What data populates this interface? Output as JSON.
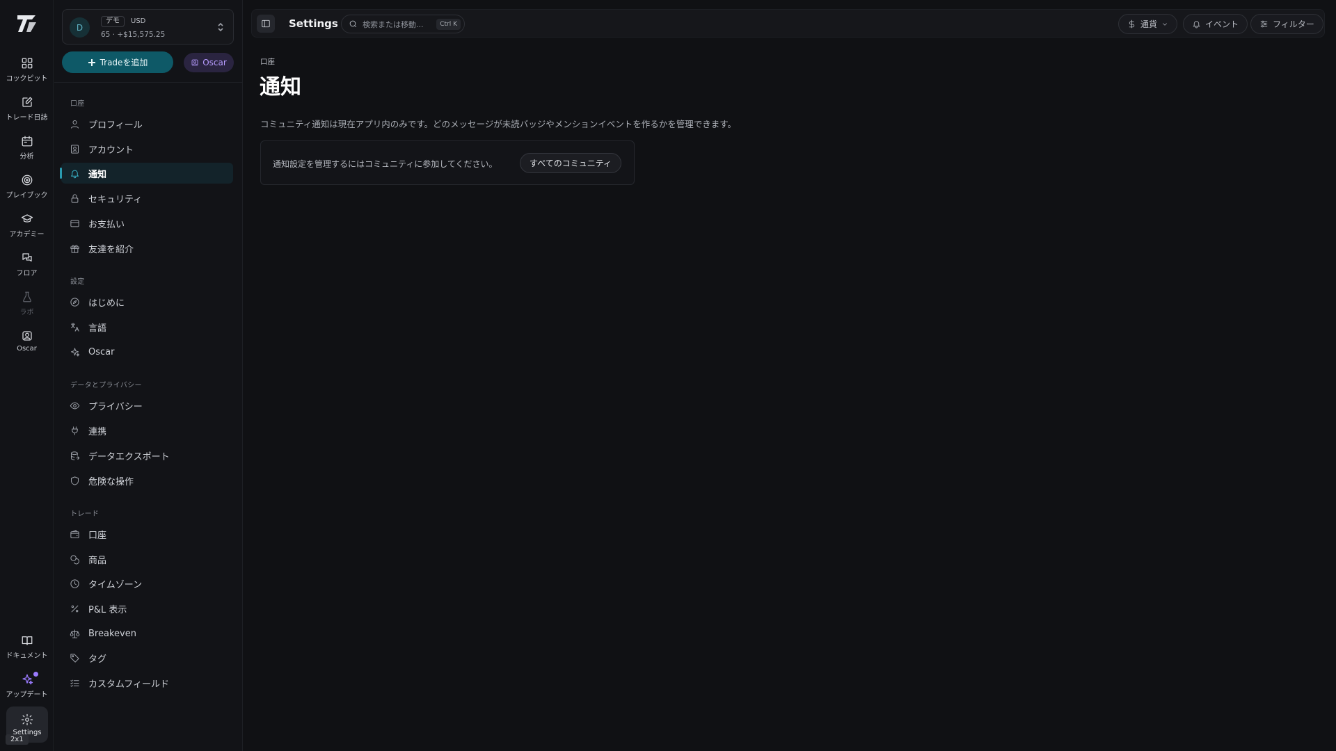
{
  "rail": {
    "items": [
      {
        "label": "コックピット",
        "icon": "dashboard-icon"
      },
      {
        "label": "トレード日誌",
        "icon": "journal-edit-icon"
      },
      {
        "label": "分析",
        "icon": "calendar-icon"
      },
      {
        "label": "プレイブック",
        "icon": "target-icon"
      },
      {
        "label": "アカデミー",
        "icon": "graduation-cap-icon"
      },
      {
        "label": "フロア",
        "icon": "chat-bubbles-icon"
      },
      {
        "label": "ラボ",
        "icon": "flask-icon"
      },
      {
        "label": "Oscar",
        "icon": "bot-icon"
      }
    ],
    "docs_label": "ドキュメント",
    "updates_label": "アップデート",
    "settings_label": "Settings",
    "zoom_badge": "2x1"
  },
  "account": {
    "avatar_initial": "D",
    "mode_chip": "デモ",
    "currency": "USD",
    "summary": "65 · +$15,575.25"
  },
  "actions": {
    "add_trade_label": "Tradeを追加",
    "oscar_label": "Oscar"
  },
  "sidebar": {
    "groups": [
      {
        "label": "口座",
        "items": [
          {
            "label": "プロフィール",
            "icon": "user-icon"
          },
          {
            "label": "アカウント",
            "icon": "id-card-icon"
          },
          {
            "label": "通知",
            "icon": "bell-icon",
            "active": true
          },
          {
            "label": "セキュリティ",
            "icon": "lock-icon"
          },
          {
            "label": "お支払い",
            "icon": "credit-card-icon"
          },
          {
            "label": "友達を紹介",
            "icon": "gift-icon"
          }
        ]
      },
      {
        "label": "設定",
        "items": [
          {
            "label": "はじめに",
            "icon": "compass-icon"
          },
          {
            "label": "言語",
            "icon": "translate-icon"
          },
          {
            "label": "Oscar",
            "icon": "sparkle-icon"
          }
        ]
      },
      {
        "label": "データとプライバシー",
        "items": [
          {
            "label": "プライバシー",
            "icon": "eye-icon"
          },
          {
            "label": "連携",
            "icon": "plug-icon"
          },
          {
            "label": "データエクスポート",
            "icon": "database-export-icon"
          },
          {
            "label": "危険な操作",
            "icon": "shield-icon"
          }
        ]
      },
      {
        "label": "トレード",
        "items": [
          {
            "label": "口座",
            "icon": "wallet-icon"
          },
          {
            "label": "商品",
            "icon": "coins-icon"
          },
          {
            "label": "タイムゾーン",
            "icon": "clock-icon"
          },
          {
            "label": "P&L 表示",
            "icon": "percent-icon"
          },
          {
            "label": "Breakeven",
            "icon": "scale-icon"
          },
          {
            "label": "タグ",
            "icon": "tag-icon"
          },
          {
            "label": "カスタムフィールド",
            "icon": "list-check-icon"
          }
        ]
      }
    ]
  },
  "topbar": {
    "title": "Settings",
    "search_placeholder": "検索または移動...",
    "search_shortcut": "Ctrl K",
    "currency_label": "通貨",
    "events_label": "イベント",
    "filter_label": "フィルター"
  },
  "page": {
    "breadcrumb": "口座",
    "title": "通知",
    "description": "コミュニティ通知は現在アプリ内のみです。どのメッセージが未読バッジやメンションイベントを作るかを管理できます。",
    "notice_text": "通知設定を管理するにはコミュニティに参加してください。",
    "notice_button": "すべてのコミュニティ"
  },
  "colors": {
    "background": "#101114",
    "panel": "#121317",
    "accent": "#0e5967",
    "accent_active": "#2a9bb0",
    "oscar_purple": "#b79cff"
  }
}
